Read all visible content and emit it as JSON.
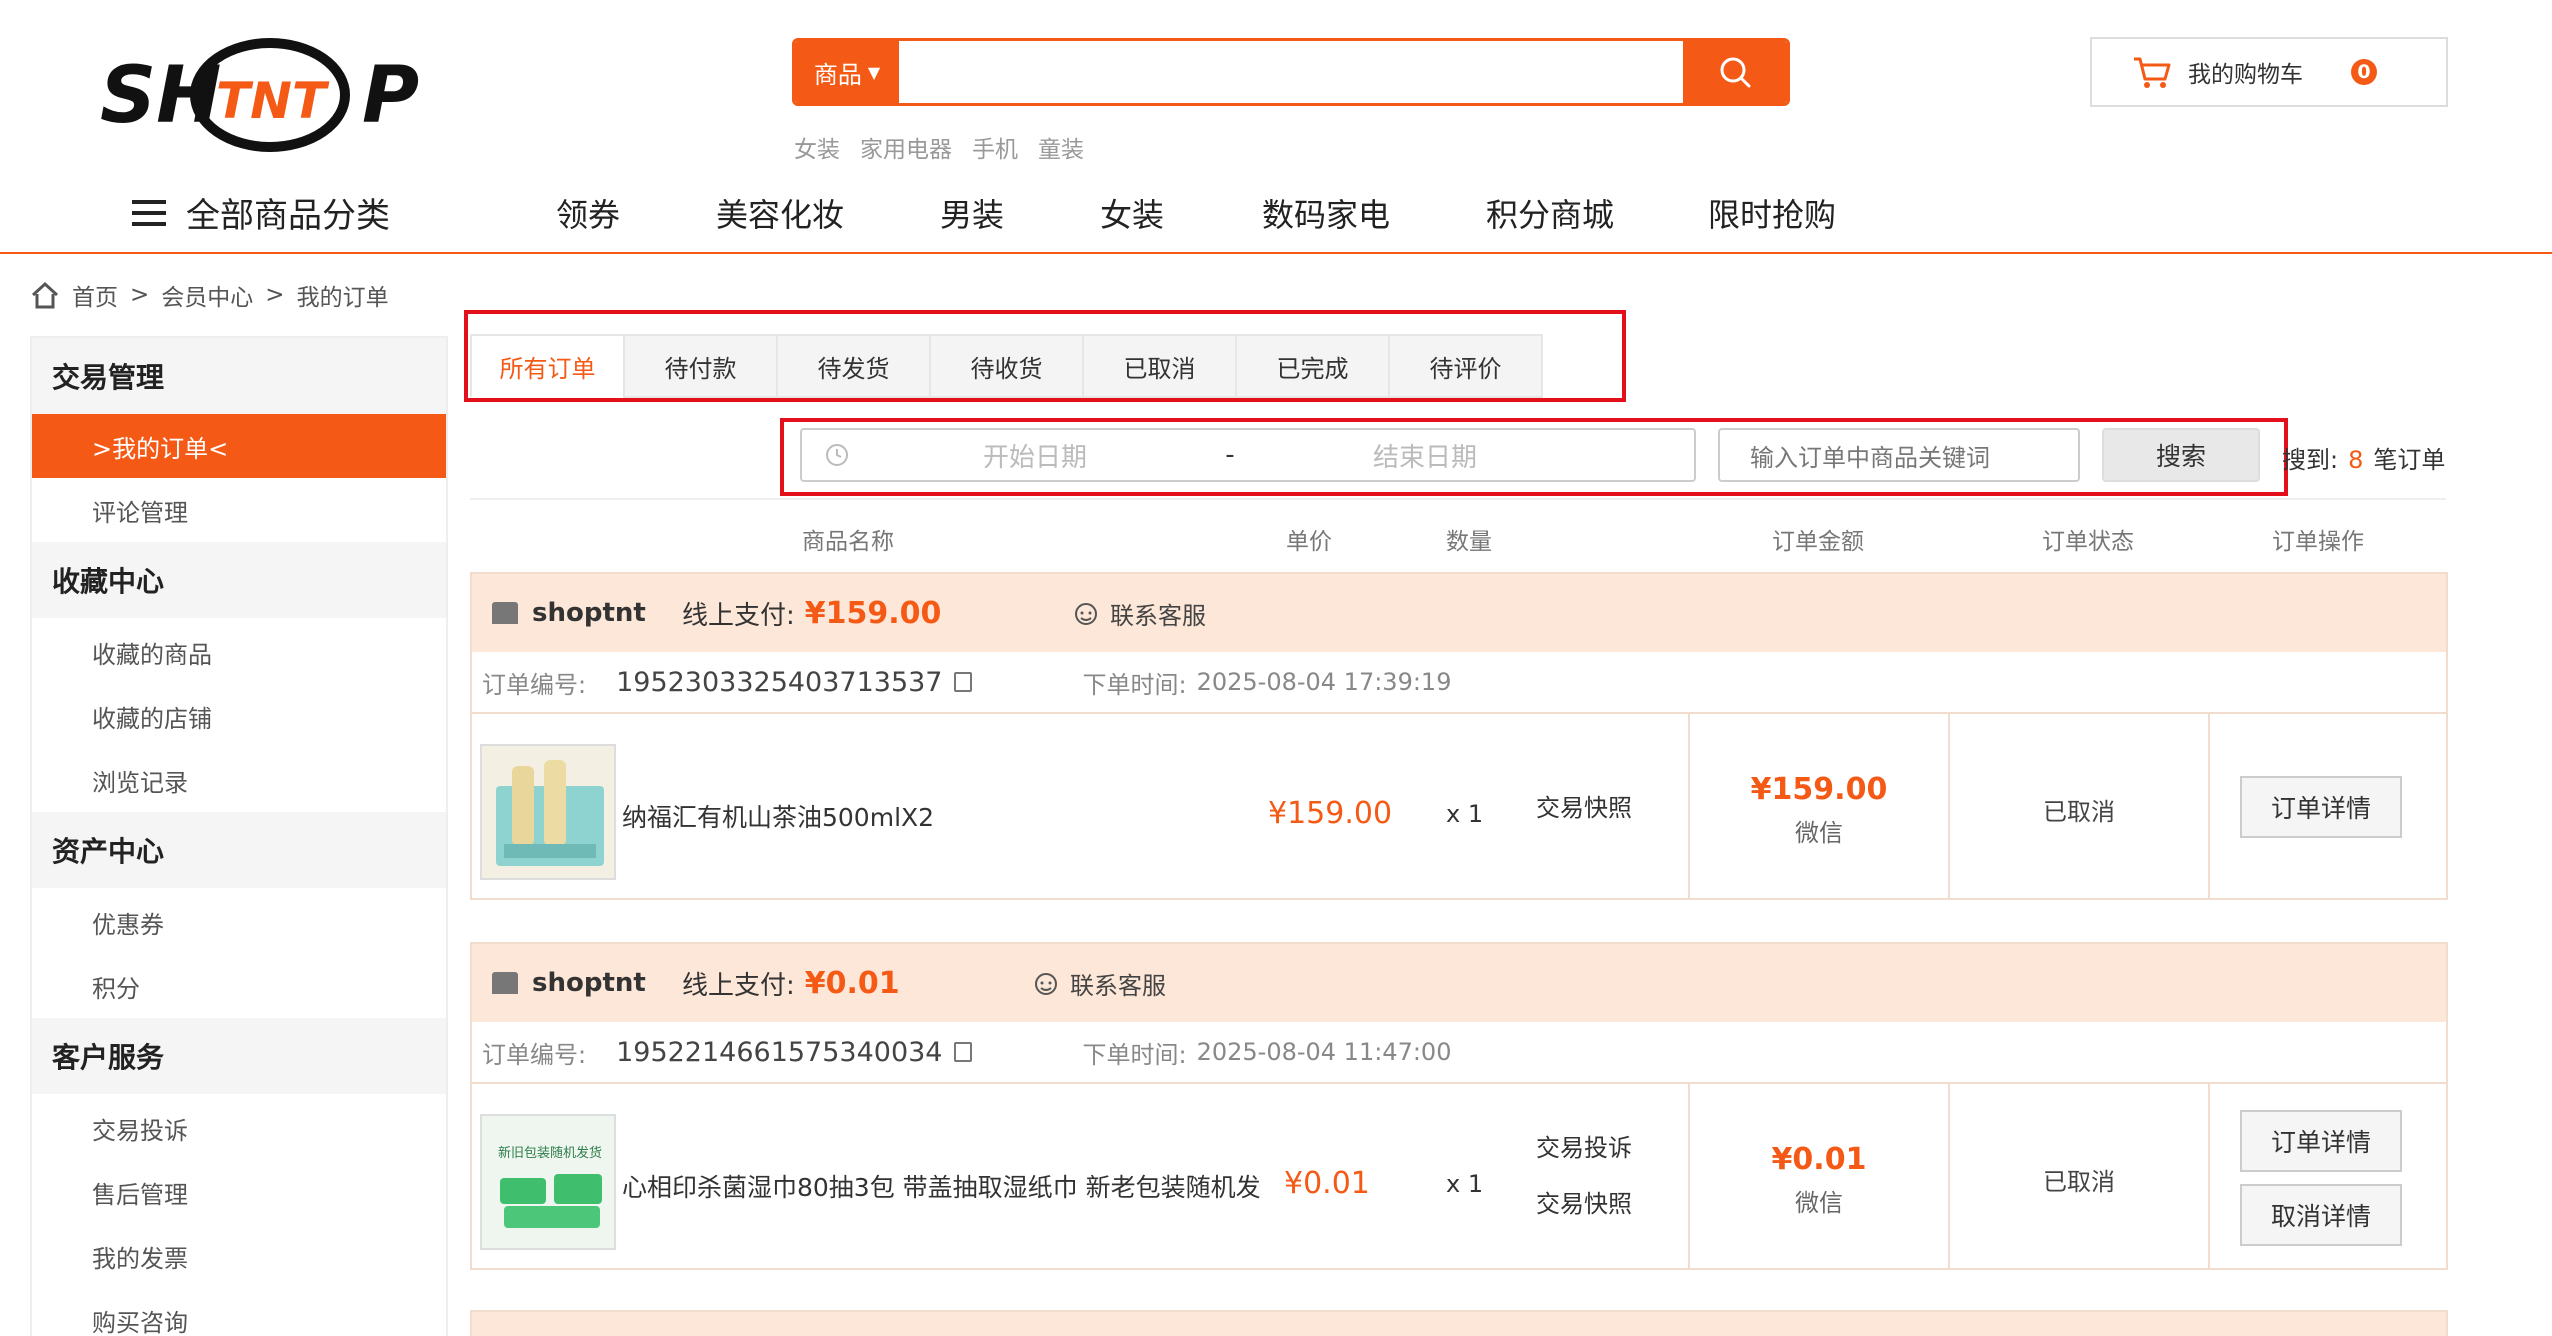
{
  "header": {
    "logo_text": "SHTNTP",
    "search_category": "商品",
    "search_placeholder": "",
    "hot_words": [
      "女装",
      "家用电器",
      "手机",
      "童装"
    ],
    "cart_label": "我的购物车",
    "cart_count": "0"
  },
  "nav": {
    "all_categories": "全部商品分类",
    "items": [
      "领券",
      "美容化妆",
      "男装",
      "女装",
      "数码家电",
      "积分商城",
      "限时抢购"
    ]
  },
  "breadcrumb": {
    "items": [
      "首页",
      "会员中心",
      "我的订单"
    ],
    "separator": ">"
  },
  "sidebar": {
    "groups": [
      {
        "title": "交易管理",
        "items": [
          ">我的订单<",
          "评论管理"
        ]
      },
      {
        "title": "收藏中心",
        "items": [
          "收藏的商品",
          "收藏的店铺",
          "浏览记录"
        ]
      },
      {
        "title": "资产中心",
        "items": [
          "优惠券",
          "积分"
        ]
      },
      {
        "title": "客户服务",
        "items": [
          "交易投诉",
          "售后管理",
          "我的发票",
          "购买咨询"
        ]
      }
    ]
  },
  "tabs": [
    "所有订单",
    "待付款",
    "待发货",
    "待收货",
    "已取消",
    "已完成",
    "待评价"
  ],
  "filter": {
    "start_date": "开始日期",
    "dash": "-",
    "end_date": "结束日期",
    "keyword_placeholder": "输入订单中商品关键词",
    "search_button": "搜索",
    "result_prefix": "搜到:",
    "result_count": "8",
    "result_suffix": "笔订单"
  },
  "columns": [
    "商品名称",
    "单价",
    "数量",
    "订单金额",
    "订单状态",
    "订单操作"
  ],
  "orders": [
    {
      "shop": "shoptnt",
      "pay_label": "线上支付:",
      "pay_amount": "¥159.00",
      "service": "联系客服",
      "sn_label": "订单编号:",
      "sn": "1952303325403713537",
      "time_label": "下单时间:",
      "time": "2025-08-04 17:39:19",
      "product": "纳福汇有机山茶油500mlX2",
      "price": "¥159.00",
      "qty": "x 1",
      "links": [
        "交易快照"
      ],
      "amount": "¥159.00",
      "method": "微信",
      "status": "已取消",
      "actions": [
        "订单详情"
      ]
    },
    {
      "shop": "shoptnt",
      "pay_label": "线上支付:",
      "pay_amount": "¥0.01",
      "service": "联系客服",
      "sn_label": "订单编号:",
      "sn": "1952214661575340034",
      "time_label": "下单时间:",
      "time": "2025-08-04 11:47:00",
      "product": "心相印杀菌湿巾80抽3包 带盖抽取湿纸巾 新老包装随机发",
      "thumb_text": "新旧包装随机发货",
      "price": "¥0.01",
      "qty": "x 1",
      "links": [
        "交易投诉",
        "交易快照"
      ],
      "amount": "¥0.01",
      "method": "微信",
      "status": "已取消",
      "actions": [
        "订单详情",
        "取消详情"
      ]
    }
  ],
  "colors": {
    "accent": "#f45a16",
    "highlight_box": "#e3101b",
    "order_head_bg": "#fce7d8"
  }
}
